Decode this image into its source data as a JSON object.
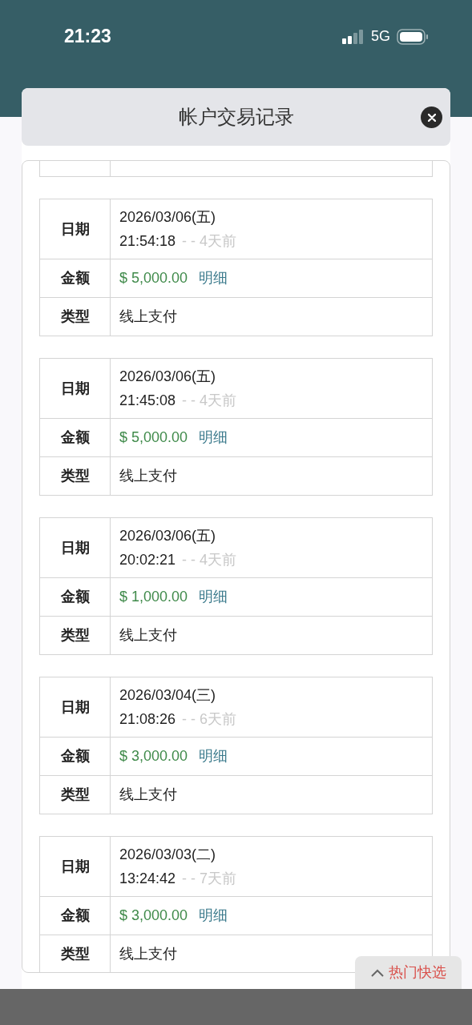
{
  "status_bar": {
    "time": "21:23",
    "network": "5G"
  },
  "modal": {
    "title": "帐户交易记录"
  },
  "records": [
    {
      "date_label": "日期",
      "date": "2026/03/06(五)",
      "time": "21:54:18",
      "ago": "- - 4天前",
      "amount_label": "金额",
      "amount": "$ 5,000.00",
      "detail_link": "明细",
      "type_label": "类型",
      "type": "线上支付"
    },
    {
      "date_label": "日期",
      "date": "2026/03/06(五)",
      "time": "21:45:08",
      "ago": "- - 4天前",
      "amount_label": "金额",
      "amount": "$ 5,000.00",
      "detail_link": "明细",
      "type_label": "类型",
      "type": "线上支付"
    },
    {
      "date_label": "日期",
      "date": "2026/03/06(五)",
      "time": "20:02:21",
      "ago": "- - 4天前",
      "amount_label": "金额",
      "amount": "$ 1,000.00",
      "detail_link": "明细",
      "type_label": "类型",
      "type": "线上支付"
    },
    {
      "date_label": "日期",
      "date": "2026/03/04(三)",
      "time": "21:08:26",
      "ago": "- - 6天前",
      "amount_label": "金额",
      "amount": "$ 3,000.00",
      "detail_link": "明细",
      "type_label": "类型",
      "type": "线上支付"
    },
    {
      "date_label": "日期",
      "date": "2026/03/03(二)",
      "time": "13:24:42",
      "ago": "- - 7天前",
      "amount_label": "金额",
      "amount": "$ 3,000.00",
      "detail_link": "明细",
      "type_label": "类型",
      "type": "线上支付"
    }
  ],
  "floating_button": {
    "label": "热门快选"
  }
}
